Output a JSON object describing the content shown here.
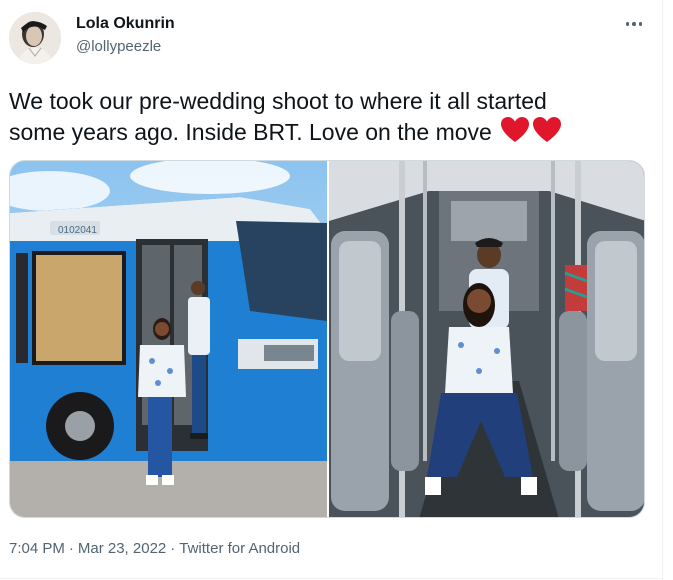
{
  "author": {
    "name": "Lola Okunrin",
    "handle": "@lollypeezle",
    "avatar_icon": "person-avatar"
  },
  "more_menu_icon": "ellipsis-horizontal-icon",
  "tweet": {
    "line1": "We took our pre-wedding shoot to where it all started",
    "line2": "some years ago. Inside BRT. Love on the move",
    "emoji": "red-heart x2",
    "heart_color": "#e0162b"
  },
  "media": {
    "bus_number": "0102041"
  },
  "meta": {
    "time": "7:04 PM",
    "date": "Mar 23, 2022",
    "client": "Twitter for Android",
    "separator": "·"
  },
  "colors": {
    "text_primary": "#0f1419",
    "text_secondary": "#536471",
    "bus_blue": "#1f7fd3",
    "border": "#cfd9de"
  }
}
